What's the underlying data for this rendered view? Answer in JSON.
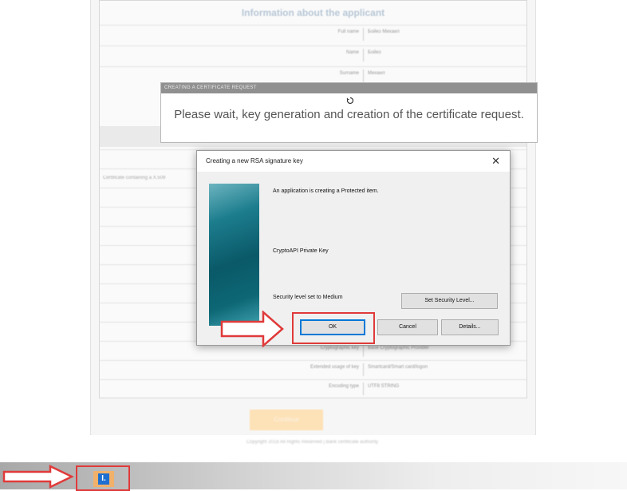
{
  "form": {
    "title": "Information about the applicant",
    "rows": [
      {
        "label": "Full name",
        "value": "Бойко Михаил"
      },
      {
        "label": "Name",
        "value": "Бойко"
      },
      {
        "label": "Surname",
        "value": "Михаил"
      }
    ],
    "side_label": "Certificate containing a X.509",
    "bottom_rows": [
      {
        "label": "Cryptographic key",
        "value": "Base Cryptographic Provider"
      },
      {
        "label": "Extended usage of key",
        "value": "Smartcard/Smart card/logon"
      },
      {
        "label": "Encoding type",
        "value": "UTF8 STRING"
      }
    ],
    "continue_label": "Continue"
  },
  "copyright": "Copyright 2018 All Rights Reserved | Bank certificate authority",
  "cert_panel": {
    "header": "CREATING A CERTIFICATE REQUEST",
    "message": "Please wait, key generation and creation of the certificate request."
  },
  "dialog": {
    "title": "Creating a new RSA signature key",
    "close_glyph": "✕",
    "info": "An application is creating a Protected item.",
    "key_name": "CryptoAPI Private Key",
    "security_text": "Security level set to Medium",
    "set_security_label": "Set Security Level...",
    "ok_label": "OK",
    "cancel_label": "Cancel",
    "details_label": "Details..."
  },
  "taskbar": {
    "app_icon_glyph": "I."
  },
  "colors": {
    "highlight_red": "#e03a3a",
    "accent_blue": "#0078d7",
    "task_icon_orange": "#f1b16a",
    "continue_orange": "#fde1b7"
  },
  "icons": {
    "arrow_pointer": "right-arrow-outline-icon",
    "spinner": "loading-spinner-icon",
    "app": "app-taskbar-icon"
  }
}
